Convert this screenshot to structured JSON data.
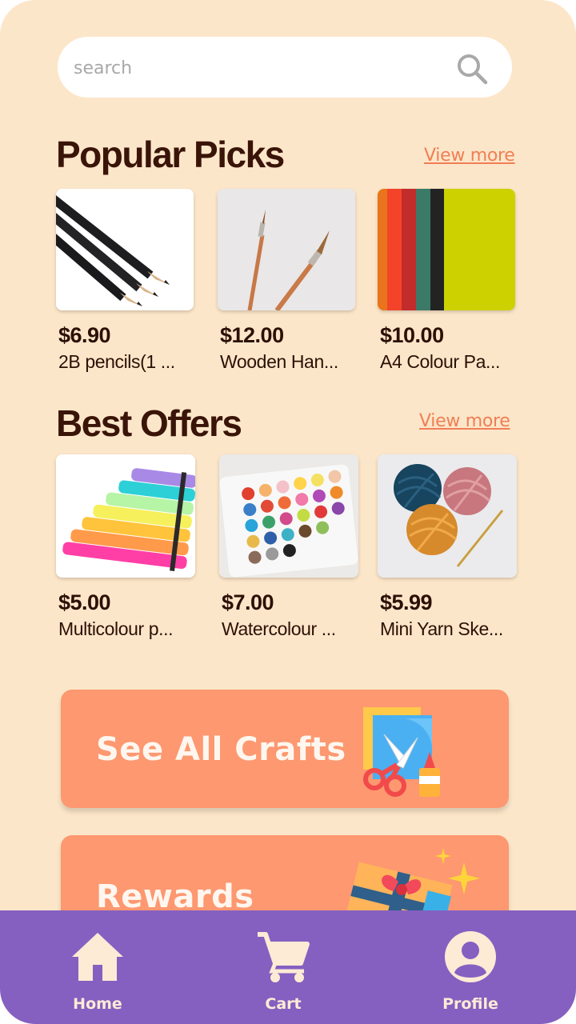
{
  "search": {
    "placeholder": "search",
    "icon": "search-icon"
  },
  "popular": {
    "title": "Popular Picks",
    "view_more": "View more",
    "items": [
      {
        "price": "$6.90",
        "name": "2B pencils(1 ..."
      },
      {
        "price": "$12.00",
        "name": "Wooden Han..."
      },
      {
        "price": "$10.00",
        "name": "A4 Colour Pa..."
      }
    ]
  },
  "offers": {
    "title": "Best Offers",
    "view_more": "View more",
    "items": [
      {
        "price": "$5.00",
        "name": "Multicolour p..."
      },
      {
        "price": "$7.00",
        "name": "Watercolour ..."
      },
      {
        "price": "$5.99",
        "name": "Mini Yarn Ske..."
      }
    ]
  },
  "banners": {
    "crafts": "See All Crafts",
    "rewards": "Rewards"
  },
  "nav": {
    "home": "Home",
    "cart": "Cart",
    "profile": "Profile"
  },
  "colors": {
    "background": "#fce6c9",
    "accent": "#fd9870",
    "link": "#ef7f55",
    "navbar": "#8560c1",
    "text": "#2b1006"
  }
}
